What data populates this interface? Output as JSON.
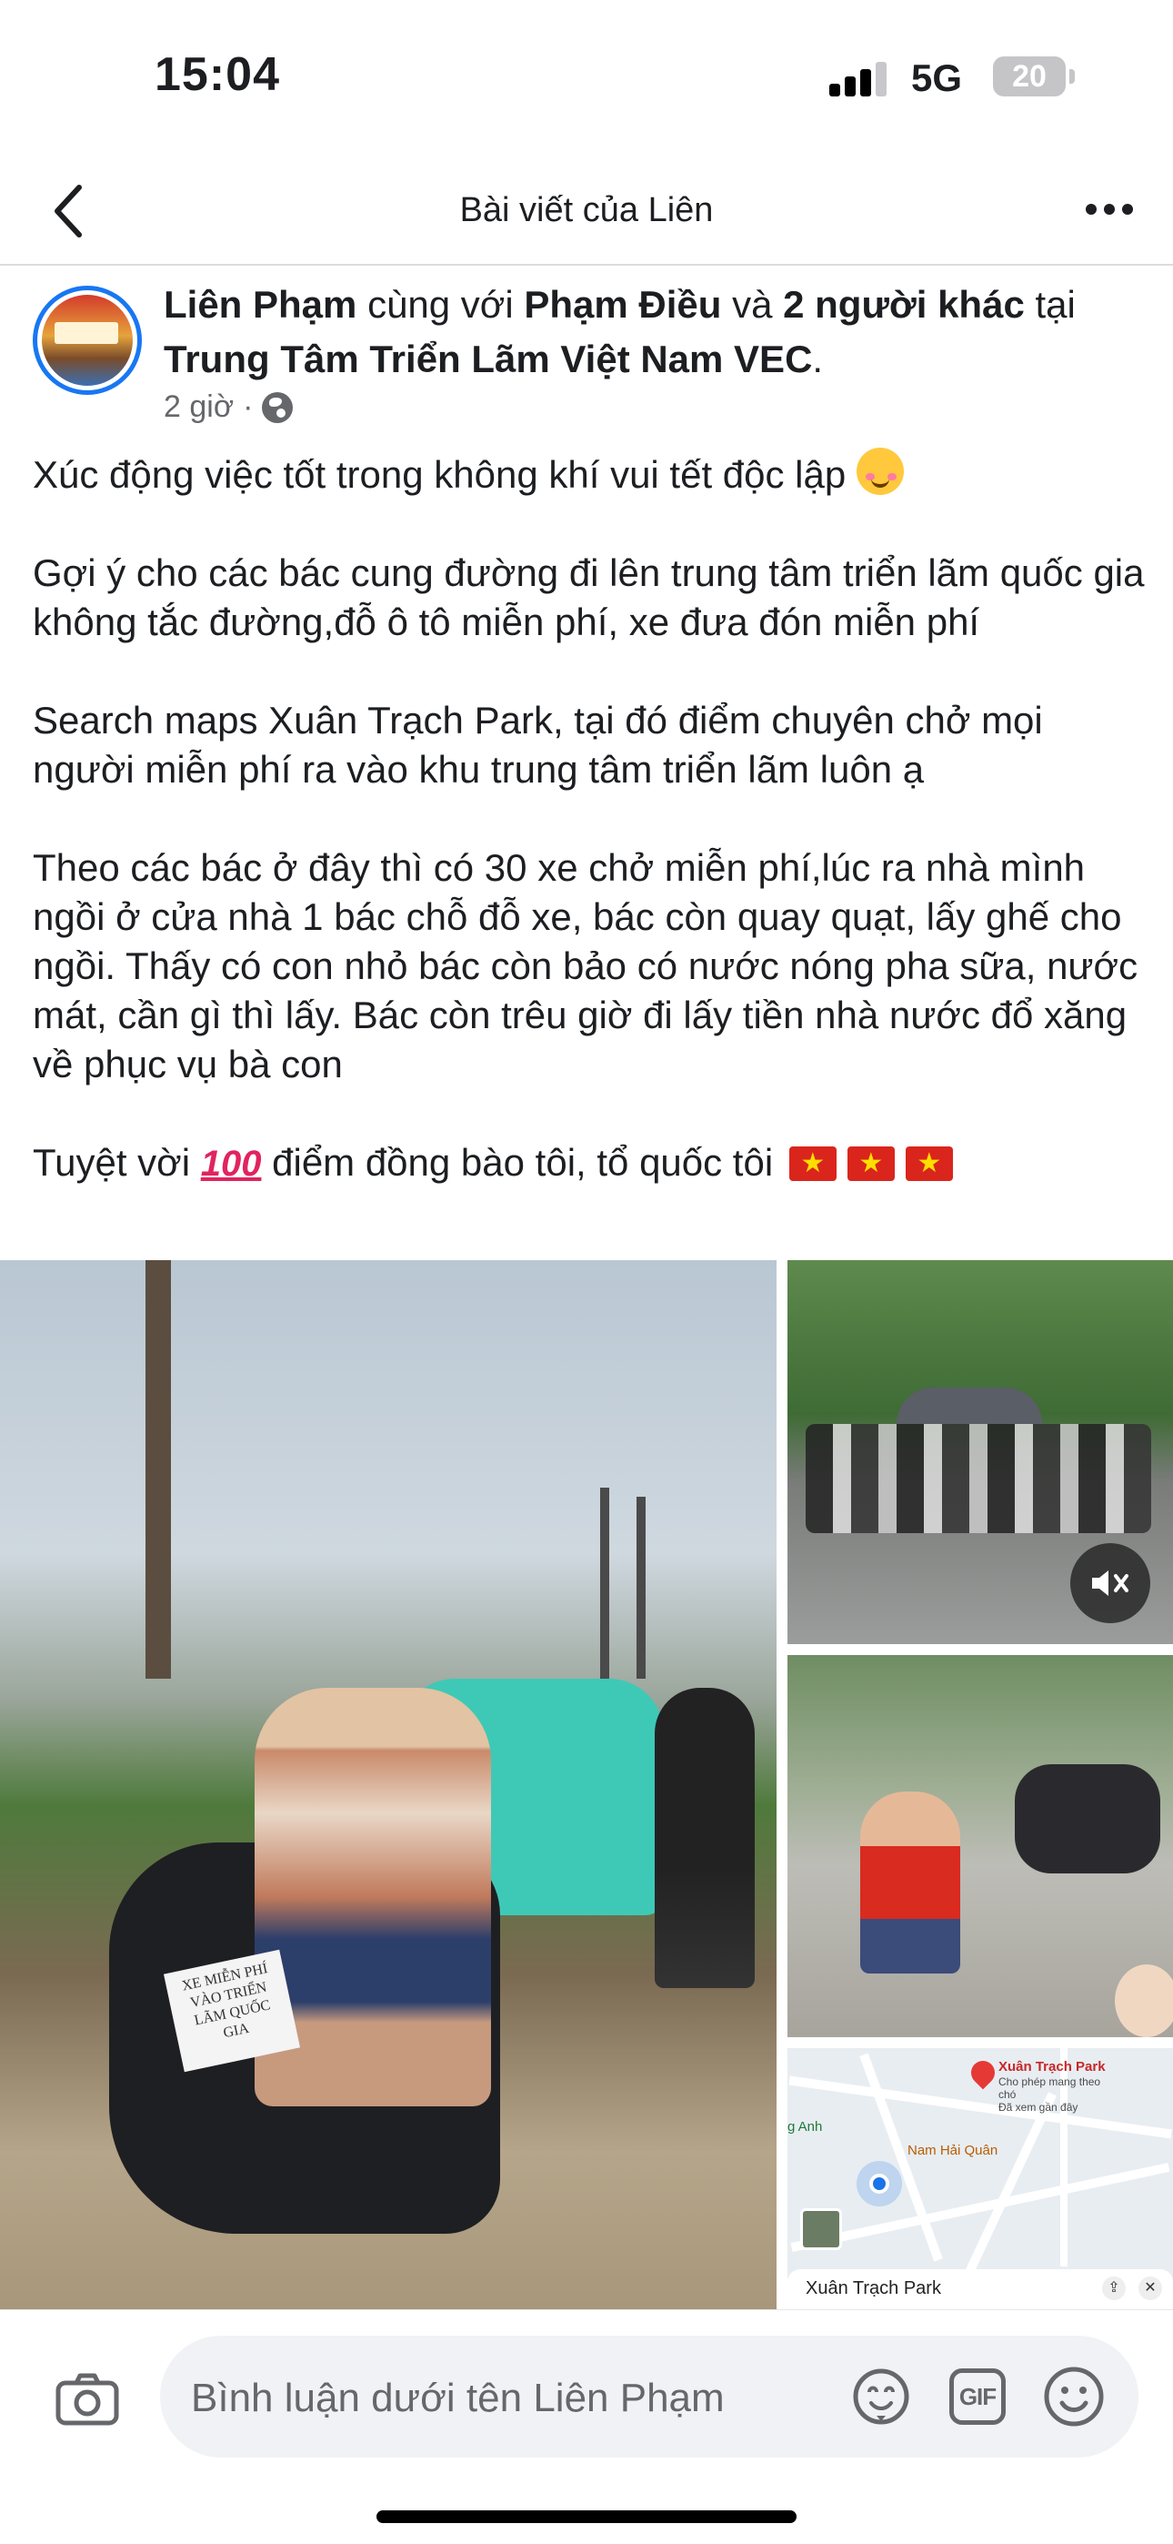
{
  "status_bar": {
    "time": "15:04",
    "network": "5G",
    "battery": "20"
  },
  "header": {
    "title": "Bài viết của Liên"
  },
  "post": {
    "author": "Liên Phạm",
    "with_text": "cùng với",
    "tagged": "Phạm Điều",
    "and_text": "và",
    "others": "2 người khác",
    "at_text": "tại",
    "location": "Trung Tâm Triển Lãm Việt Nam VEC",
    "period": ".",
    "time": "2 giờ",
    "dot": "·",
    "paragraphs": {
      "p1": "Xúc động việc tốt trong không khí vui tết độc lập",
      "p2": "Gợi ý cho các bác cung đường đi lên trung tâm triển lãm quốc gia không tắc đường,đỗ ô tô miễn phí, xe đưa đón miễn phí",
      "p3": "Search maps Xuân Trạch Park, tại đó điểm chuyên chở mọi người miễn phí ra vào khu trung tâm triển lãm luôn ạ",
      "p4": "Theo các bác ở đây thì có 30 xe chở miễn phí,lúc ra nhà mình ngồi ở cửa nhà 1 bác chỗ đỗ xe, bác còn quay quạt, lấy ghế cho ngồi. Thấy có con nhỏ bác còn bảo có nước nóng pha sữa, nước mát, cần gì thì lấy. Bác còn trêu giờ đi lấy tiền nhà nước đổ xăng về phục vụ bà con",
      "p5_start": "Tuyệt vời",
      "p5_end": "điểm đồng bào tôi, tổ quốc tôi",
      "emoji_100": "100"
    }
  },
  "photos": {
    "sign_text": "XE MIỄN PHÍ VÀO TRIỂN LÃM QUỐC GIA",
    "map": {
      "place_name": "Xuân Trạch Park",
      "place_sub1": "Cho phép mang theo",
      "place_sub2": "chó",
      "place_sub3": "Đã xem gần đây",
      "label_left": "g Anh",
      "label_mid": "Nam Hải Quân",
      "sheet_title": "Xuân Trạch Park"
    }
  },
  "comment": {
    "placeholder": "Bình luận dưới tên Liên Phạm",
    "gif_label": "GIF"
  },
  "colors": {
    "accent": "#1877f2",
    "text": "#1c1e21",
    "muted": "#65676b",
    "input_bg": "#f0f2f5"
  }
}
